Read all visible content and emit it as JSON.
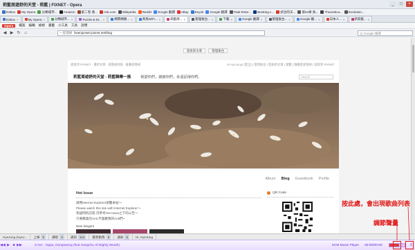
{
  "window": {
    "title": "莉藍周遊舒的天堂 - 莉藍 | FIXNET - Opera",
    "controls": [
      "_",
      "□",
      "×"
    ]
  },
  "bookmarks_row1": [
    {
      "label": "EzBox",
      "color": "#3d6fc5"
    },
    {
      "label": "My Opera",
      "color": "#d93a2b"
    },
    {
      "label": "分類城市...",
      "color": "#4a9d4a"
    },
    {
      "label": "Amazon",
      "color": "#222222"
    },
    {
      "label": "第二卷 香...",
      "color": "#9b4a2b"
    },
    {
      "label": "Ask.com",
      "color": "#c8372d"
    },
    {
      "label": "Wikipedia",
      "color": "#555555"
    },
    {
      "label": "Reddit",
      "color": "#ff5a1f"
    },
    {
      "label": "Google 翻譯",
      "color": "#4285f4"
    },
    {
      "label": "eBay",
      "color": "#e53238"
    },
    {
      "label": "Eeyok",
      "color": "#2d7bd8"
    },
    {
      "label": "Google 翻譯",
      "color": "#4285f4"
    },
    {
      "label": "Total Enter...",
      "color": "#555555"
    },
    {
      "label": "Booking.c...",
      "color": "#003580"
    },
    {
      "label": "武治的天...",
      "color": "#d93a2b"
    },
    {
      "label": "第64章 魚...",
      "color": "#5a5a5a"
    },
    {
      "label": "Theoretica...",
      "color": "#444444"
    },
    {
      "label": "Evolution...",
      "color": "#555555"
    }
  ],
  "tabs": [
    {
      "label": "EzBox",
      "color": "#3d6fc5",
      "active": false
    },
    {
      "label": "My Opera",
      "color": "#d93a2b",
      "active": false
    },
    {
      "label": "分類城市...",
      "color": "#4a9d4a",
      "active": false
    },
    {
      "label": "Puzzle & Dr...",
      "color": "#a05ad0",
      "active": false
    },
    {
      "label": "網際網路...",
      "color": "#2d7bd8",
      "active": false
    },
    {
      "label": "青鳥WiFi...",
      "color": "#2d7bd8",
      "active": false
    },
    {
      "label": "莉藍周...",
      "color": "#c03d7a",
      "active": true
    },
    {
      "label": "管理後台...",
      "color": "#555555",
      "active": false
    },
    {
      "label": "下載",
      "color": "#4a9d4a",
      "active": false
    },
    {
      "label": "Google 翻譯",
      "color": "#4285f4",
      "active": false
    },
    {
      "label": "管理後台...",
      "color": "#555555",
      "active": false
    },
    {
      "label": "Google 翻...",
      "color": "#4285f4",
      "active": false
    },
    {
      "label": "日本人...",
      "color": "#d93a2b",
      "active": false
    },
    {
      "label": "新莉藍...",
      "color": "#c03d7a",
      "active": false
    }
  ],
  "menu": [
    "Opera",
    "檔案",
    "編輯",
    "檢視",
    "書籤",
    "小工具",
    "工具",
    "說明"
  ],
  "address": {
    "label": "一般連線",
    "url": "liwenjunwei.pixnet.net/blog",
    "search_placeholder": "以 Google 搜尋"
  },
  "page": {
    "top_buttons": [
      "發表新文章",
      "管理後台"
    ],
    "util_left": "痞客邦 PIXNET  ·  最新文章  ·  部落格目錄  ·  推薦部落格",
    "util_right": "Hi HyeJung! (登出) | 管理後台 | 發表新文章 | 瀏覽 | 隨機逛部落格 | 痞客邦 PIXNET",
    "blog_title": "莉藍周遊舒的天堂 - 莉藍韓樂一族",
    "slogan": "我愛你們，謝謝你們，永遠記得你們。",
    "search_mini": "Search",
    "nav": [
      {
        "label": "Album",
        "active": false
      },
      {
        "label": "Blog",
        "active": true
      },
      {
        "label": "Guestbook",
        "active": false
      },
      {
        "label": "Profile",
        "active": false
      }
    ],
    "hot_issue_title": "Hot Issue",
    "hot_lines": [
      "請用Internet Explorer瀏覽本站～",
      "Please watch this site with Internet Explorer～",
      "有疑問的訪客,可參考Hot Issue之下的公告～",
      "只要歡喜的Anti,不喜歡我的Anti們~"
    ],
    "new_singers": "New Singers",
    "qr_title": "QR Code"
  },
  "statusbar": [
    {
      "label": "HyeJung (HyeJ...",
      "num": ""
    },
    {
      "label": "上線",
      "num": "6"
    },
    {
      "label": "讀取",
      "num": "3"
    },
    {
      "label": "通知",
      "num": "114"
    },
    {
      "label": "最新動態",
      "num": "6"
    },
    {
      "label": "通知",
      "num": "6"
    },
    {
      "label": "Hi, HyeJung",
      "num": ""
    }
  ],
  "player": {
    "controls": [
      "◀◀",
      "▶",
      "■",
      "▶▶"
    ],
    "song": "G.NA - Oppa, Dongsaeng (feat Sangchu of Mighty Mouth)",
    "brand": "SCM Music Player",
    "time": "00:00/00:00",
    "volume": 0.6,
    "list_icon": "≡"
  },
  "annotations": {
    "list_hint": "按此處，會出現歌曲列表",
    "volume_hint": "調節聲量"
  }
}
